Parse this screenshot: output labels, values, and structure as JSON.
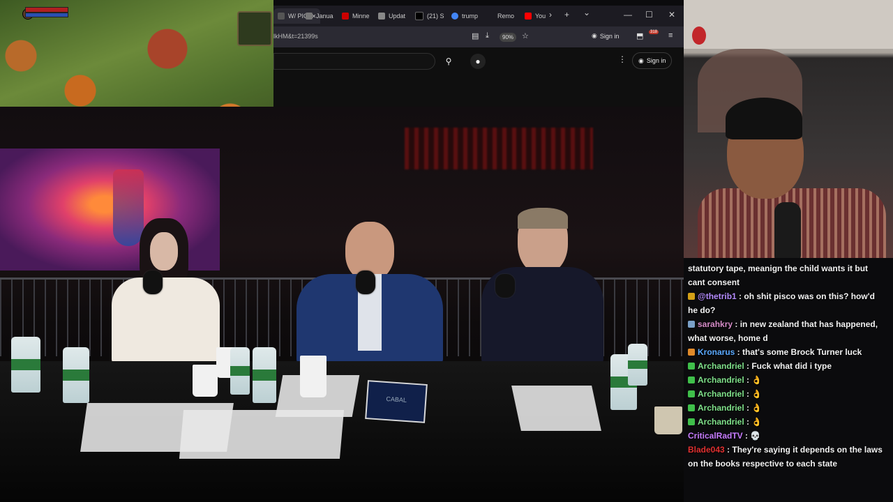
{
  "game": {
    "labels": []
  },
  "browser": {
    "tabs": [
      {
        "label": "W/ PIC",
        "color": "#555"
      },
      {
        "label": "Janua",
        "color": "#777"
      },
      {
        "label": "Minne",
        "color": "#cc0000"
      },
      {
        "label": "Updat",
        "color": "#888"
      },
      {
        "label": "(21) S",
        "color": "#000000"
      },
      {
        "label": "trump",
        "color": "#4285f4"
      },
      {
        "label": "Remo",
        "color": "#555"
      },
      {
        "label": "You",
        "color": "#ff0000"
      }
    ],
    "url": "lkHM&t=21399s",
    "zoom": "90%",
    "signin_label": "Sign in",
    "badge": "318",
    "yt_signin_label": "Sign in",
    "icons": {
      "chevron": "›",
      "add": "+",
      "dropdown": "⌄",
      "minimize": "—",
      "maximize": "☐",
      "close": "✕",
      "tab_close": "✕",
      "reader": "▤",
      "download": "⤓",
      "star": "☆",
      "account": "◉",
      "extensions": "⬒",
      "menu": "≡",
      "search": "⚲",
      "mic": "●",
      "kebab": "⋮"
    }
  },
  "chat": {
    "messages": [
      {
        "user": "",
        "user_color": "#ffffff",
        "text": "statutory tape, meanign the child wants it but",
        "icon": ""
      },
      {
        "user": "",
        "user_color": "#ffffff",
        "text": "cant consent",
        "icon": ""
      },
      {
        "user": "@thetrib1",
        "user_color": "#b58cff",
        "text": " : oh shit pisco was on this? how'd",
        "icon": "#d4a017"
      },
      {
        "user": "",
        "user_color": "#ffffff",
        "text": "he do?",
        "icon": ""
      },
      {
        "user": "sarahkry",
        "user_color": "#d58cc8",
        "text": " : in new zealand that has happened,",
        "icon": "#7aa0c8"
      },
      {
        "user": "",
        "user_color": "#ffffff",
        "text": "what worse, home d",
        "icon": ""
      },
      {
        "user": "Kronarus",
        "user_color": "#5aa9ff",
        "text": " : that's some Brock Turner luck",
        "icon": "#e08a2a"
      },
      {
        "user": "Archandriel",
        "user_color": "#7fe08a",
        "text": " : Fuck what did i type",
        "icon": "#3fbf4a"
      },
      {
        "user": "Archandriel",
        "user_color": "#7fe08a",
        "text": " : 👌",
        "icon": "#3fbf4a"
      },
      {
        "user": "Archandriel",
        "user_color": "#7fe08a",
        "text": " : 👌",
        "icon": "#3fbf4a"
      },
      {
        "user": "Archandriel",
        "user_color": "#7fe08a",
        "text": " : 👌",
        "icon": "#3fbf4a"
      },
      {
        "user": "Archandriel",
        "user_color": "#7fe08a",
        "text": " : 👌",
        "icon": "#3fbf4a"
      },
      {
        "user": "CriticalRadTV",
        "user_color": "#c77dff",
        "text": " : 💀",
        "icon": ""
      },
      {
        "user": "Blade043",
        "user_color": "#e03030",
        "text": " : They're saying it depends on the laws",
        "icon": ""
      },
      {
        "user": "",
        "user_color": "#ffffff",
        "text": "on the books respective to each state",
        "icon": ""
      }
    ]
  },
  "studio": {
    "book_title": "CABAL"
  }
}
